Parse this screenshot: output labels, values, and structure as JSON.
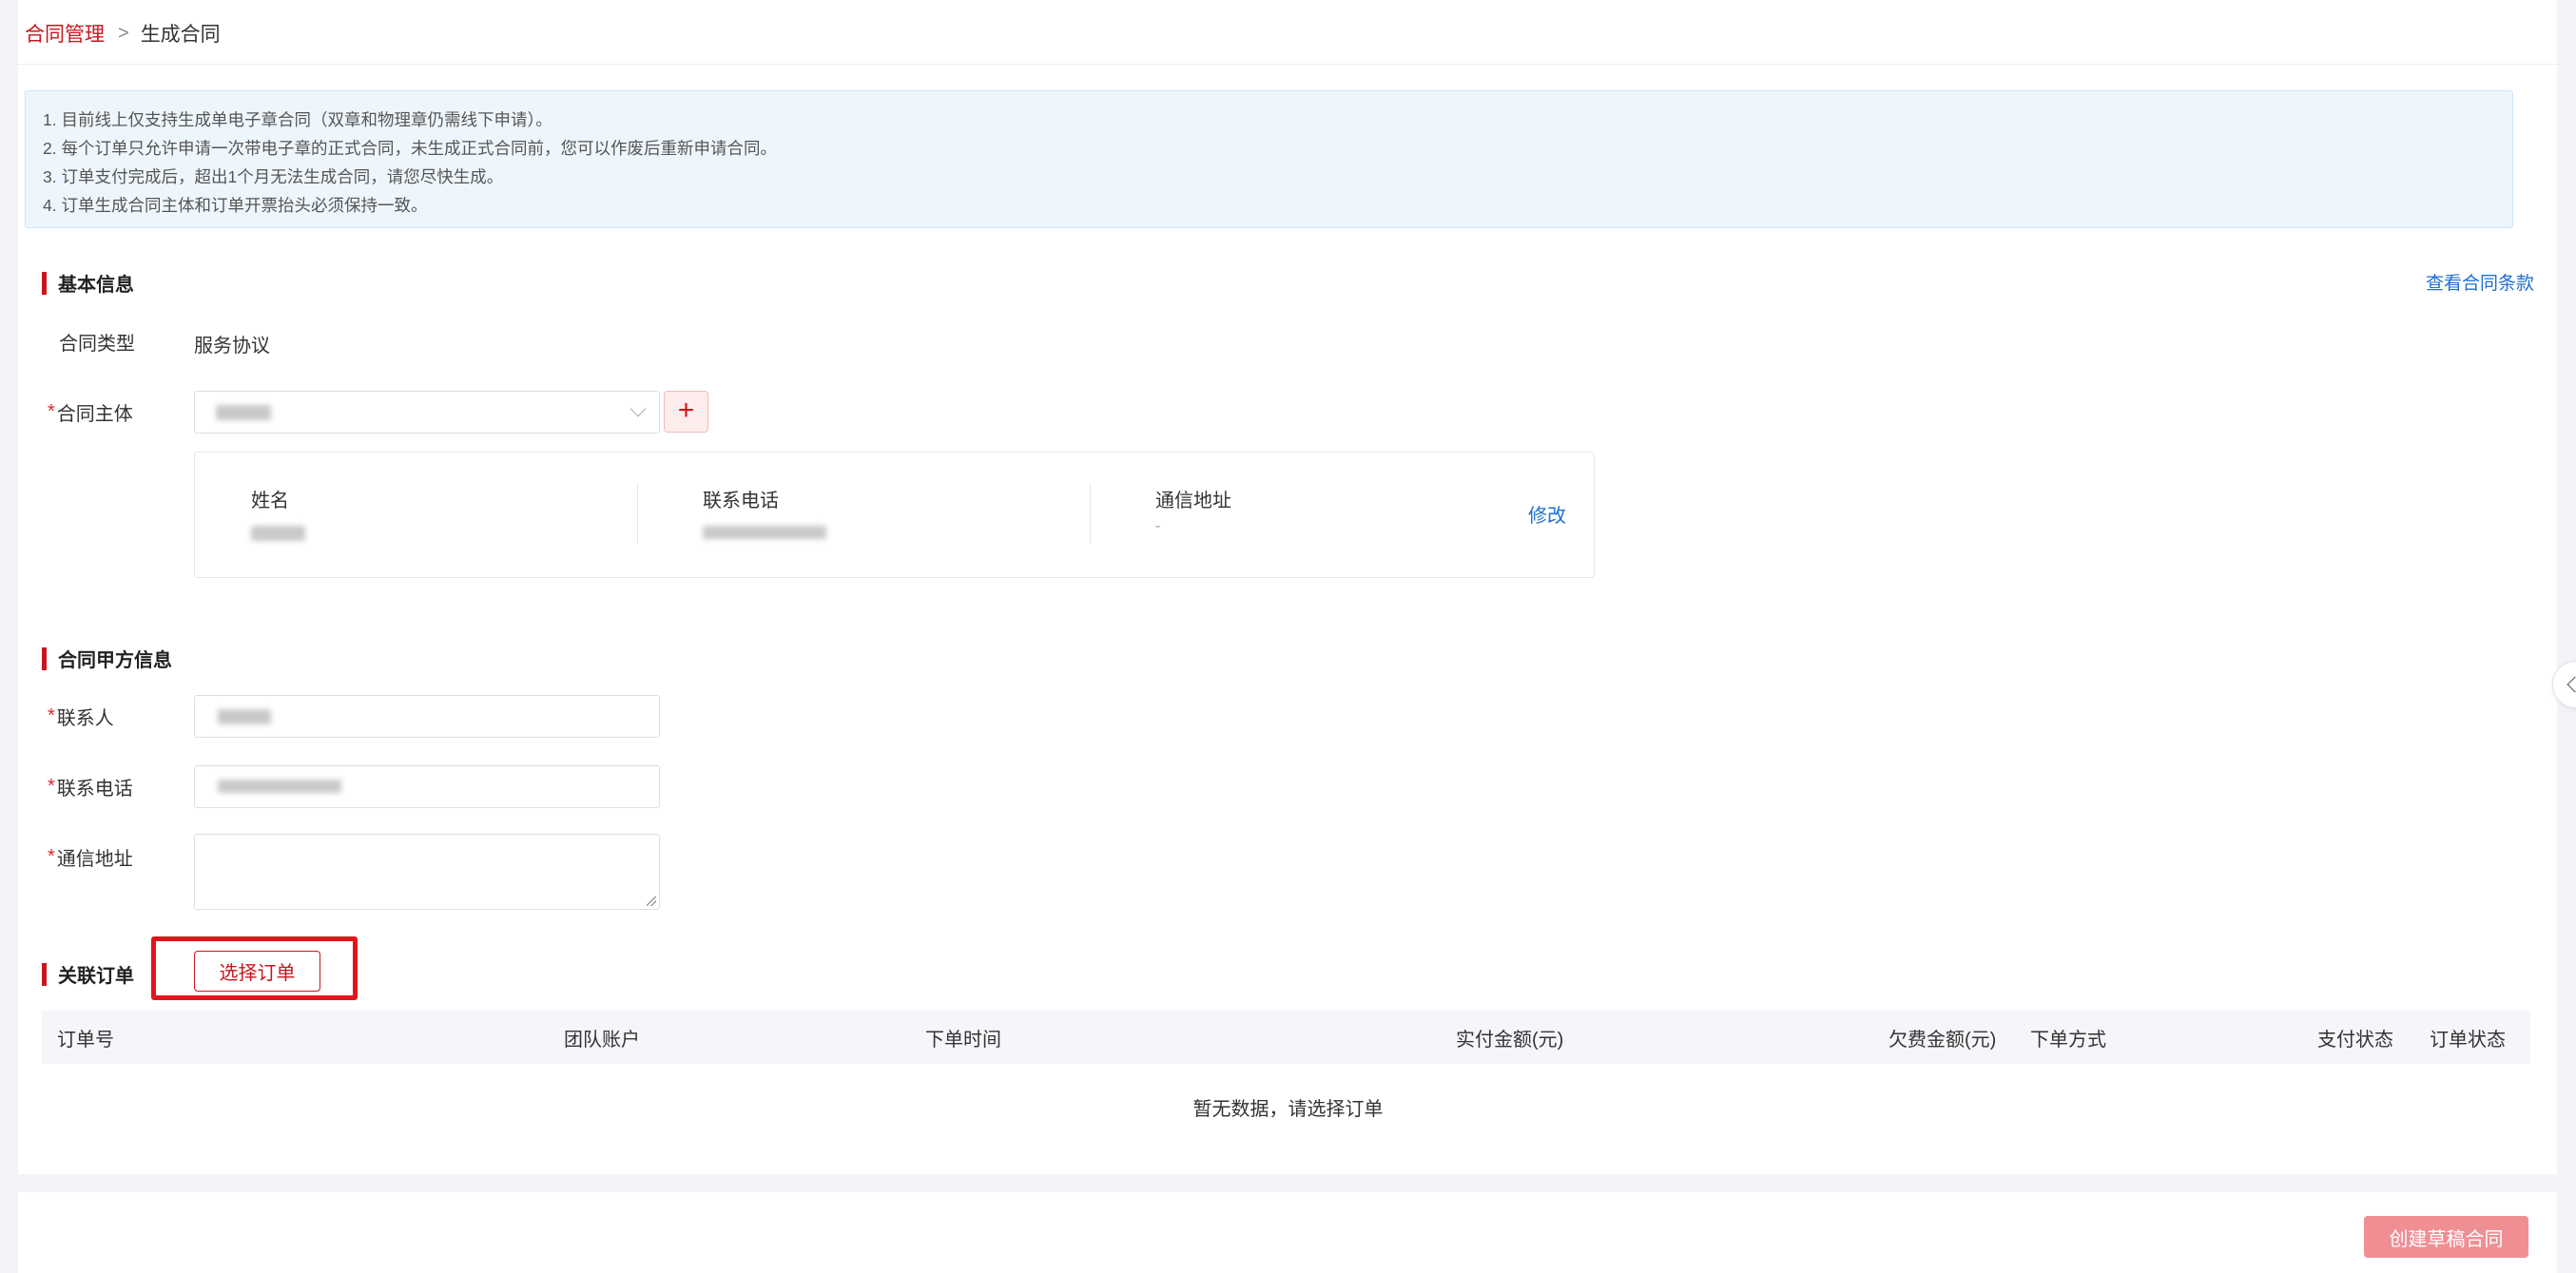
{
  "breadcrumb": {
    "parent": "合同管理",
    "separator": ">",
    "current": "生成合同"
  },
  "notice": [
    "1. 目前线上仅支持生成单电子章合同（双章和物理章仍需线下申请）。",
    "2. 每个订单只允许申请一次带电子章的正式合同，未生成正式合同前，您可以作废后重新申请合同。",
    "3. 订单支付完成后，超出1个月无法生成合同，请您尽快生成。",
    "4. 订单生成合同主体和订单开票抬头必须保持一致。"
  ],
  "basic_info": {
    "title": "基本信息",
    "view_terms_link": "查看合同条款",
    "contract_type_label": "合同类型",
    "contract_type_value": "服务协议",
    "subject_label": "合同主体",
    "add_subject": "+",
    "subject_card": {
      "name_label": "姓名",
      "phone_label": "联系电话",
      "address_label": "通信地址",
      "address_value": "-",
      "edit_link": "修改"
    }
  },
  "party_a": {
    "title": "合同甲方信息",
    "contact_label": "联系人",
    "phone_label": "联系电话",
    "address_label": "通信地址"
  },
  "orders": {
    "title": "关联订单",
    "select_button": "选择订单",
    "columns": [
      "订单号",
      "团队账户",
      "下单时间",
      "实付金额(元)",
      "欠费金额(元)",
      "下单方式",
      "支付状态",
      "订单状态"
    ],
    "empty_text": "暂无数据，请选择订单"
  },
  "footer": {
    "create_button": "创建草稿合同"
  },
  "colors": {
    "brand": "#c8161d",
    "link": "#1f6fd1",
    "highlight": "#e3141b"
  },
  "icons": {
    "breadcrumb_separator": "chevron-right-icon",
    "select_arrow": "chevron-down-icon",
    "sidebar_toggle": "chevron-left-icon"
  }
}
